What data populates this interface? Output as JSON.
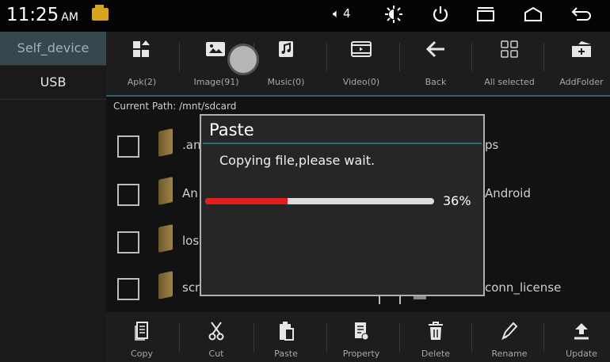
{
  "status": {
    "time": "11:25",
    "ampm": "AM",
    "volume_value": "4",
    "icons": [
      "sdcard-icon",
      "volume-icon",
      "brightness-icon",
      "power-icon",
      "recent-apps-icon",
      "home-icon",
      "back-icon"
    ]
  },
  "sidebar": {
    "items": [
      {
        "label": "Self_device",
        "active": true
      },
      {
        "label": "USB",
        "active": false
      }
    ]
  },
  "toolbar": {
    "items": [
      {
        "label": "Apk(2)",
        "icon": "apk-grid-icon"
      },
      {
        "label": "Image(91)",
        "icon": "image-icon"
      },
      {
        "label": "Music(0)",
        "icon": "music-icon"
      },
      {
        "label": "Video(0)",
        "icon": "video-icon"
      },
      {
        "label": "Back",
        "icon": "arrow-left-icon"
      },
      {
        "label": "All selected",
        "icon": "select-all-icon"
      },
      {
        "label": "AddFolder",
        "icon": "add-folder-icon"
      }
    ]
  },
  "path": {
    "label": "Current Path:",
    "value": "/mnt/sdcard"
  },
  "files": {
    "left": [
      ".an",
      "An",
      "los",
      "scr"
    ],
    "right": [
      "ps",
      "Android",
      "",
      "conn_license"
    ]
  },
  "bottombar": {
    "items": [
      {
        "label": "Copy",
        "icon": "copy-icon"
      },
      {
        "label": "Cut",
        "icon": "scissors-icon"
      },
      {
        "label": "Paste",
        "icon": "paste-icon"
      },
      {
        "label": "Property",
        "icon": "property-icon"
      },
      {
        "label": "Delete",
        "icon": "trash-icon"
      },
      {
        "label": "Rename",
        "icon": "pen-icon"
      },
      {
        "label": "Update",
        "icon": "upload-icon"
      }
    ]
  },
  "dialog": {
    "title": "Paste",
    "message": "Copying file,please wait.",
    "progress_percent": 36,
    "progress_label": "36%"
  },
  "colors": {
    "accent": "#2f6b7a",
    "progress_fill": "#e01e1e",
    "sidebar_active": "#37474f"
  }
}
